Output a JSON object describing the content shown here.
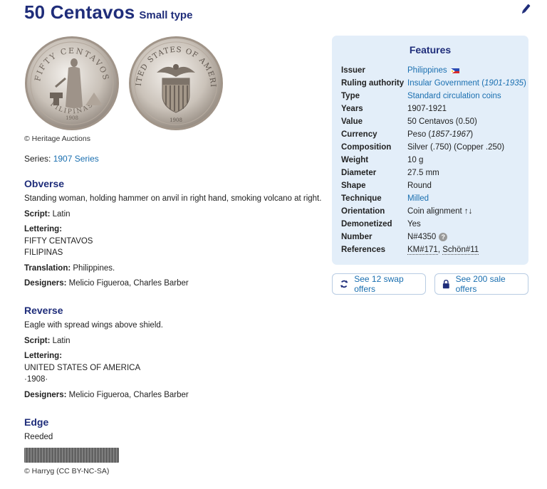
{
  "header": {
    "title": "50 Centavos",
    "subtitle": "Small type"
  },
  "images": {
    "photo_credit": "© Heritage Auctions",
    "obverse_coin_text": [
      "FIFTY CENTAVOS",
      "FILIPINAS",
      "1908"
    ],
    "reverse_coin_text": [
      "UNITED STATES OF AMERICA",
      "1908"
    ]
  },
  "series": {
    "label": "Series:",
    "value": "1907 Series"
  },
  "obverse": {
    "heading": "Obverse",
    "description": "Standing woman, holding hammer on anvil in right hand, smoking volcano at right.",
    "script_label": "Script:",
    "script": "Latin",
    "lettering_label": "Lettering:",
    "lettering": [
      "FIFTY CENTAVOS",
      "FILIPINAS"
    ],
    "translation_label": "Translation:",
    "translation": "Philippines.",
    "designers_label": "Designers:",
    "designers": "Melicio Figueroa, Charles Barber"
  },
  "reverse": {
    "heading": "Reverse",
    "description": "Eagle with spread wings above shield.",
    "script_label": "Script:",
    "script": "Latin",
    "lettering_label": "Lettering:",
    "lettering": [
      "UNITED STATES OF AMERICA",
      "·1908·"
    ],
    "designers_label": "Designers:",
    "designers": "Melicio Figueroa, Charles Barber"
  },
  "edge": {
    "heading": "Edge",
    "description": "Reeded",
    "credit": "© Harryg (CC BY-NC-SA)"
  },
  "features": {
    "title": "Features",
    "rows": {
      "issuer": {
        "key": "Issuer",
        "value": "Philippines"
      },
      "ruling": {
        "key": "Ruling authority",
        "value": "Insular Government",
        "years": "1901-1935"
      },
      "type": {
        "key": "Type",
        "value": "Standard circulation coins"
      },
      "years": {
        "key": "Years",
        "value": "1907-1921"
      },
      "value": {
        "key": "Value",
        "value": "50 Centavos (0.50)"
      },
      "currency": {
        "key": "Currency",
        "value": "Peso",
        "years": "1857-1967"
      },
      "composition": {
        "key": "Composition",
        "value": "Silver (.750) (Copper .250)"
      },
      "weight": {
        "key": "Weight",
        "value": "10 g"
      },
      "diameter": {
        "key": "Diameter",
        "value": "27.5 mm"
      },
      "shape": {
        "key": "Shape",
        "value": "Round"
      },
      "technique": {
        "key": "Technique",
        "value": "Milled"
      },
      "orientation": {
        "key": "Orientation",
        "value": "Coin alignment ↑↓"
      },
      "demonetized": {
        "key": "Demonetized",
        "value": "Yes"
      },
      "number": {
        "key": "Number",
        "value": "N#4350"
      },
      "references": {
        "key": "References",
        "ref1": "KM#171",
        "ref2": "Schön#11"
      }
    }
  },
  "actions": {
    "swap": "See 12 swap offers",
    "sale": "See 200 sale offers"
  },
  "colors": {
    "heading": "#1f2d7a",
    "link": "#1a6fb0",
    "panel": "#e3eef9"
  }
}
